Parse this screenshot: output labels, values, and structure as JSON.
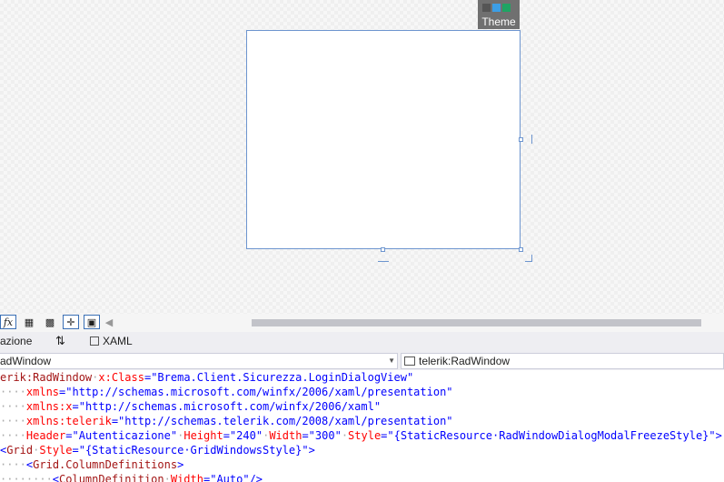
{
  "theme": {
    "label": "Theme",
    "swatches": [
      "#555555",
      "#3c9ee5",
      "#1fa463"
    ]
  },
  "toolbar": {
    "buttons": [
      {
        "name": "formula-fx-icon",
        "glyph": "𝑓x"
      },
      {
        "name": "grid-icon",
        "glyph": "▦"
      },
      {
        "name": "snap-grid-icon",
        "glyph": "▩"
      },
      {
        "name": "snap-lines-icon",
        "glyph": "✛"
      },
      {
        "name": "document-icon",
        "glyph": "▣"
      }
    ],
    "collapse_glyph": "◀"
  },
  "tabs": {
    "left": "azione",
    "swap": "⇅",
    "xaml": "XAML"
  },
  "nav": {
    "left_combo": "adWindow",
    "right_combo": "telerik:RadWindow"
  },
  "code": {
    "lines": [
      [
        [
          "el",
          "erik:RadWindow"
        ],
        [
          "ws",
          "·"
        ],
        [
          "attr",
          "x:Class"
        ],
        [
          "br",
          "=\""
        ],
        [
          "val",
          "Brema.Client.Sicurezza.LoginDialogView"
        ],
        [
          "br",
          "\""
        ]
      ],
      [
        [
          "ws",
          "····"
        ],
        [
          "attr",
          "xmlns"
        ],
        [
          "br",
          "=\""
        ],
        [
          "val",
          "http://schemas.microsoft.com/winfx/2006/xaml/presentation"
        ],
        [
          "br",
          "\""
        ]
      ],
      [
        [
          "ws",
          "····"
        ],
        [
          "attr",
          "xmlns:x"
        ],
        [
          "br",
          "=\""
        ],
        [
          "val",
          "http://schemas.microsoft.com/winfx/2006/xaml"
        ],
        [
          "br",
          "\""
        ]
      ],
      [
        [
          "ws",
          "····"
        ],
        [
          "attr",
          "xmlns:telerik"
        ],
        [
          "br",
          "=\""
        ],
        [
          "val",
          "http://schemas.telerik.com/2008/xaml/presentation"
        ],
        [
          "br",
          "\""
        ]
      ],
      [
        [
          "ws",
          "····"
        ],
        [
          "attr",
          "Header"
        ],
        [
          "br",
          "=\""
        ],
        [
          "val",
          "Autenticazione"
        ],
        [
          "br",
          "\""
        ],
        [
          "ws",
          "·"
        ],
        [
          "attr",
          "Height"
        ],
        [
          "br",
          "=\""
        ],
        [
          "val",
          "240"
        ],
        [
          "br",
          "\""
        ],
        [
          "ws",
          "·"
        ],
        [
          "attr",
          "Width"
        ],
        [
          "br",
          "=\""
        ],
        [
          "val",
          "300"
        ],
        [
          "br",
          "\""
        ],
        [
          "ws",
          "·"
        ],
        [
          "attr",
          "Style"
        ],
        [
          "br",
          "=\""
        ],
        [
          "val",
          "{StaticResource·RadWindowDialogModalFreezeStyle}"
        ],
        [
          "br",
          "\">"
        ]
      ],
      [
        [
          "br",
          "<"
        ],
        [
          "el",
          "Grid"
        ],
        [
          "ws",
          "·"
        ],
        [
          "attr",
          "Style"
        ],
        [
          "br",
          "=\""
        ],
        [
          "val",
          "{StaticResource·GridWindowsStyle}"
        ],
        [
          "br",
          "\">"
        ]
      ],
      [
        [
          "ws",
          "····"
        ],
        [
          "br",
          "<"
        ],
        [
          "el",
          "Grid.ColumnDefinitions"
        ],
        [
          "br",
          ">"
        ]
      ],
      [
        [
          "ws",
          "········"
        ],
        [
          "br",
          "<"
        ],
        [
          "el",
          "ColumnDefinition"
        ],
        [
          "ws",
          "·"
        ],
        [
          "attr",
          "Width"
        ],
        [
          "br",
          "=\""
        ],
        [
          "val",
          "Auto"
        ],
        [
          "br",
          "\"/>"
        ]
      ]
    ]
  }
}
